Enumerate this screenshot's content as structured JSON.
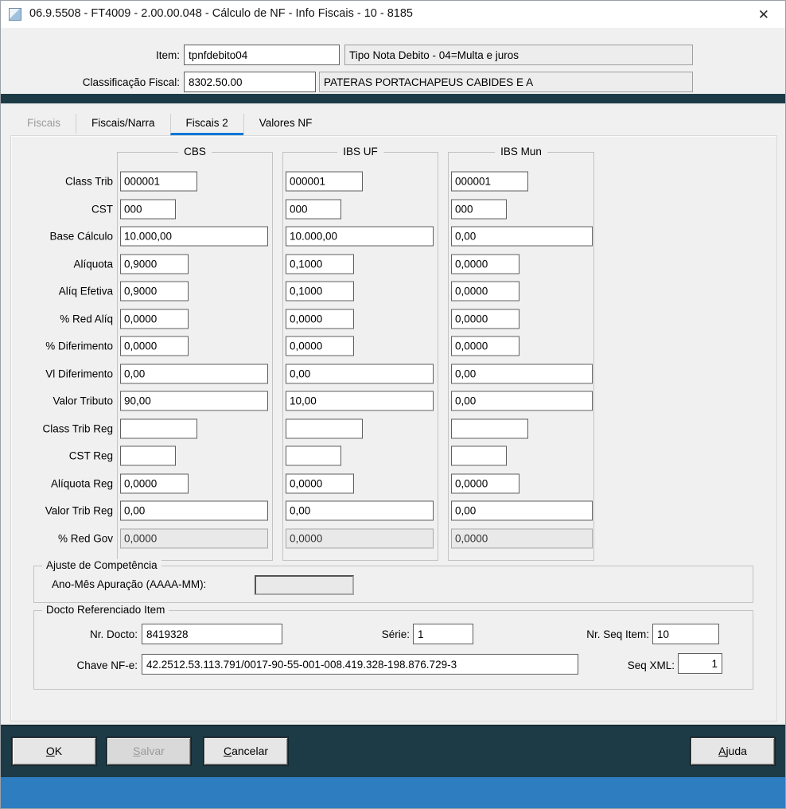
{
  "window": {
    "title": "06.9.5508 - FT4009 - 2.00.00.048 - Cálculo de NF - Info Fiscais - 10 - 8185",
    "close": "✕"
  },
  "header": {
    "item": {
      "label": "Item:",
      "value": "tpnfdebito04",
      "description": "Tipo Nota Debito - 04=Multa e juros"
    },
    "classificacao": {
      "label": "Classificação Fiscal:",
      "value": "8302.50.00",
      "description": "PATERAS PORTACHAPEUS CABIDES E A"
    }
  },
  "tabs": [
    {
      "id": "fiscais",
      "label": "Fiscais",
      "state": "disabled"
    },
    {
      "id": "fiscais-narra",
      "label": "Fiscais/Narra",
      "state": "normal"
    },
    {
      "id": "fiscais-2",
      "label": "Fiscais 2",
      "state": "active"
    },
    {
      "id": "valores-nf",
      "label": "Valores NF",
      "state": "normal"
    }
  ],
  "tax_grid": {
    "column_headers": [
      "CBS",
      "IBS UF",
      "IBS Mun"
    ],
    "rows": [
      {
        "label": "Class Trib",
        "size": "s",
        "values": [
          "000001",
          "000001",
          "000001"
        ]
      },
      {
        "label": "CST",
        "size": "xs",
        "values": [
          "000",
          "000",
          "000"
        ]
      },
      {
        "label": "Base Cálculo",
        "size": "l",
        "values": [
          "10.000,00",
          "10.000,00",
          "0,00"
        ]
      },
      {
        "label": "Alíquota",
        "size": "m",
        "values": [
          "0,9000",
          "0,1000",
          "0,0000"
        ]
      },
      {
        "label": "Alíq Efetiva",
        "size": "m",
        "values": [
          "0,9000",
          "0,1000",
          "0,0000"
        ]
      },
      {
        "label": "% Red Alíq",
        "size": "m",
        "values": [
          "0,0000",
          "0,0000",
          "0,0000"
        ]
      },
      {
        "label": "% Diferimento",
        "size": "m",
        "values": [
          "0,0000",
          "0,0000",
          "0,0000"
        ]
      },
      {
        "label": "Vl Diferimento",
        "size": "l",
        "values": [
          "0,00",
          "0,00",
          "0,00"
        ]
      },
      {
        "label": "Valor Tributo",
        "size": "l",
        "values": [
          "90,00",
          "10,00",
          "0,00"
        ]
      },
      {
        "label": "Class Trib Reg",
        "size": "s",
        "values": [
          "",
          "",
          ""
        ]
      },
      {
        "label": "CST Reg",
        "size": "xs",
        "values": [
          "",
          "",
          ""
        ]
      },
      {
        "label": "Alíquota Reg",
        "size": "m",
        "values": [
          "0,0000",
          "0,0000",
          "0,0000"
        ]
      },
      {
        "label": "Valor Trib Reg",
        "size": "l",
        "values": [
          "0,00",
          "0,00",
          "0,00"
        ]
      },
      {
        "label": "% Red Gov",
        "size": "l",
        "values": [
          "0,0000",
          "0,0000",
          "0,0000"
        ],
        "disabled": true
      }
    ]
  },
  "ajuste": {
    "title": "Ajuste de Competência",
    "apuracao_label": "Ano-Mês Apuração (AAAA-MM):",
    "apuracao_value": ""
  },
  "docto": {
    "title": "Docto Referenciado Item",
    "nr_docto_label": "Nr. Docto:",
    "nr_docto_value": "8419328",
    "serie_label": "Série:",
    "serie_value": "1",
    "seq_item_label": "Nr. Seq Item:",
    "seq_item_value": "10",
    "chave_label": "Chave NF-e:",
    "chave_value": "42.2512.53.113.791/0017-90-55-001-008.419.328-198.876.729-3",
    "seq_xml_label": "Seq XML:",
    "seq_xml_value": "1"
  },
  "footer": {
    "buttons": [
      {
        "id": "ok",
        "label": "OK",
        "state": "normal"
      },
      {
        "id": "salvar",
        "label": "Salvar",
        "state": "disabled"
      },
      {
        "id": "cancelar",
        "label": "Cancelar",
        "state": "normal"
      },
      {
        "id": "ajuda",
        "label": "Ajuda",
        "state": "normal"
      }
    ]
  },
  "colors": {
    "accent_blue": "#0078d7",
    "teal_band": "#1d3b46",
    "footer_strip_blue": "#2e7dc1"
  }
}
